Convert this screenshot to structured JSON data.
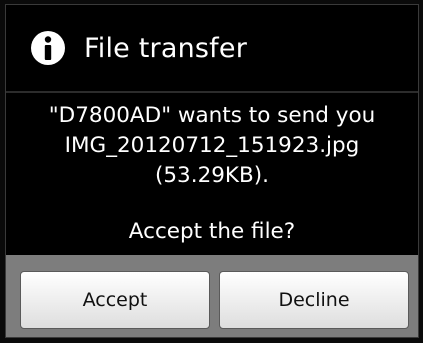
{
  "dialog": {
    "title": "File transfer",
    "icon": "info-icon",
    "message_lines": [
      "\"D7800AD\" wants to send you",
      "IMG_20120712_151923.jpg",
      "(53.29KB)."
    ],
    "question": "Accept the file?",
    "buttons": {
      "accept_label": "Accept",
      "decline_label": "Decline"
    }
  },
  "colors": {
    "dialog_background": "#000000",
    "button_bar": "#7d7d7d",
    "button_face": "#f2f2f2",
    "text": "#ffffff"
  }
}
